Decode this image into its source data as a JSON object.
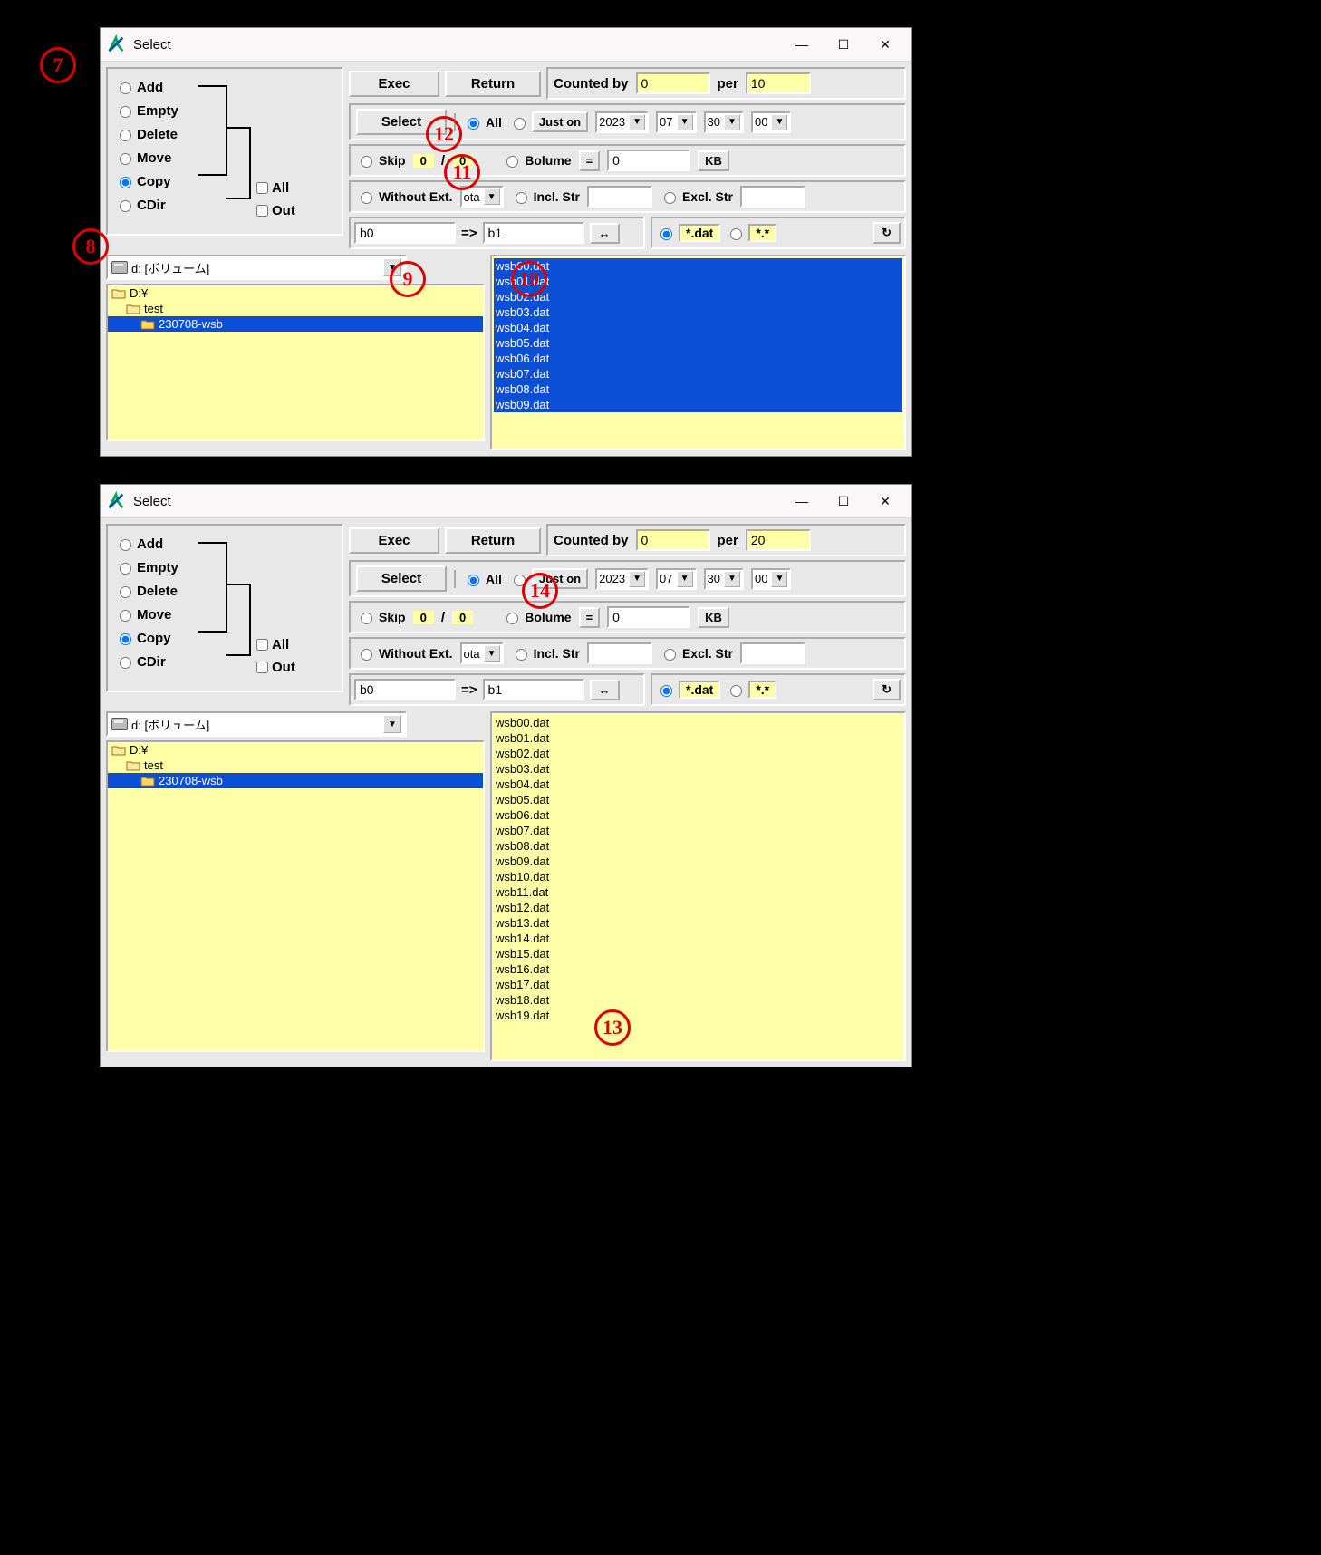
{
  "callouts": {
    "c7": "7",
    "c8": "8",
    "c9": "9",
    "c10": "10",
    "c11": "11",
    "c12": "12",
    "c13": "13",
    "c14": "14"
  },
  "win1": {
    "title": "Select",
    "mode": {
      "options": [
        "Add",
        "Empty",
        "Delete",
        "Move",
        "Copy",
        "CDir"
      ],
      "selected": "Copy",
      "checks": {
        "all": "All",
        "out": "Out"
      }
    },
    "toolbar": {
      "exec": "Exec",
      "return": "Return",
      "counted_label": "Counted by",
      "counted_value": "0",
      "per_label": "per",
      "per_value": "10"
    },
    "select_row": {
      "select_btn": "Select",
      "all": "All",
      "juston": "Just on",
      "year": "2023",
      "month": "07",
      "day": "30",
      "hour": "00"
    },
    "skip_row": {
      "skip": "Skip",
      "skip_a": "0",
      "slash": "/",
      "skip_b": "0",
      "bolume": "Bolume",
      "eq": "=",
      "bolume_val": "0",
      "kb": "KB"
    },
    "ext_row": {
      "without": "Without Ext.",
      "ext": "ota",
      "incl": "Incl. Str",
      "excl": "Excl. Str",
      "incl_val": "",
      "excl_val": ""
    },
    "rename": {
      "from": "b0",
      "arrow": "=>",
      "to": "b1",
      "swap": "↔"
    },
    "filter": {
      "dat": "*.dat",
      "all": "*.*",
      "refresh": "↻"
    },
    "drive": "d: [ボリューム]",
    "tree": [
      {
        "label": "D:¥",
        "indent": 0,
        "sel": false
      },
      {
        "label": "test",
        "indent": 1,
        "sel": false
      },
      {
        "label": "230708-wsb",
        "indent": 2,
        "sel": true
      }
    ],
    "files": [
      "wsb00.dat",
      "wsb01.dat",
      "wsb02.dat",
      "wsb03.dat",
      "wsb04.dat",
      "wsb05.dat",
      "wsb06.dat",
      "wsb07.dat",
      "wsb08.dat",
      "wsb09.dat"
    ],
    "files_selected": true
  },
  "win2": {
    "title": "Select",
    "mode": {
      "options": [
        "Add",
        "Empty",
        "Delete",
        "Move",
        "Copy",
        "CDir"
      ],
      "selected": "Copy",
      "checks": {
        "all": "All",
        "out": "Out"
      }
    },
    "toolbar": {
      "exec": "Exec",
      "return": "Return",
      "counted_label": "Counted by",
      "counted_value": "0",
      "per_label": "per",
      "per_value": "20"
    },
    "select_row": {
      "select_btn": "Select",
      "all": "All",
      "juston": "Just on",
      "year": "2023",
      "month": "07",
      "day": "30",
      "hour": "00"
    },
    "skip_row": {
      "skip": "Skip",
      "skip_a": "0",
      "slash": "/",
      "skip_b": "0",
      "bolume": "Bolume",
      "eq": "=",
      "bolume_val": "0",
      "kb": "KB"
    },
    "ext_row": {
      "without": "Without Ext.",
      "ext": "ota",
      "incl": "Incl. Str",
      "excl": "Excl. Str",
      "incl_val": "",
      "excl_val": ""
    },
    "rename": {
      "from": "b0",
      "arrow": "=>",
      "to": "b1",
      "swap": "↔"
    },
    "filter": {
      "dat": "*.dat",
      "all": "*.*",
      "refresh": "↻"
    },
    "drive": "d: [ボリューム]",
    "tree": [
      {
        "label": "D:¥",
        "indent": 0,
        "sel": false
      },
      {
        "label": "test",
        "indent": 1,
        "sel": false
      },
      {
        "label": "230708-wsb",
        "indent": 2,
        "sel": true
      }
    ],
    "files": [
      "wsb00.dat",
      "wsb01.dat",
      "wsb02.dat",
      "wsb03.dat",
      "wsb04.dat",
      "wsb05.dat",
      "wsb06.dat",
      "wsb07.dat",
      "wsb08.dat",
      "wsb09.dat",
      "wsb10.dat",
      "wsb11.dat",
      "wsb12.dat",
      "wsb13.dat",
      "wsb14.dat",
      "wsb15.dat",
      "wsb16.dat",
      "wsb17.dat",
      "wsb18.dat",
      "wsb19.dat"
    ],
    "files_selected": false
  }
}
